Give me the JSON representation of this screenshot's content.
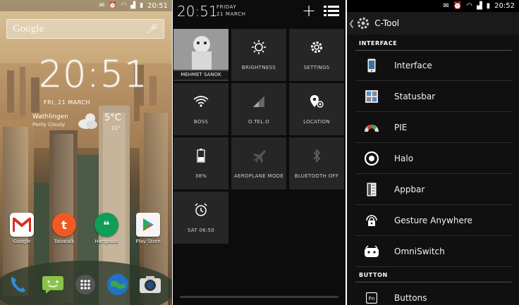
{
  "home": {
    "status_time": "20:51",
    "search_logo": "Google",
    "clock": "20:51",
    "date": "FRI, 21 MARCH",
    "weather_location": "Wathlingen",
    "weather_condition": "Partly Cloudy",
    "weather_temp": "5°C",
    "weather_hilo": "11°",
    "apps": [
      {
        "label": "Google"
      },
      {
        "label": "Tabatalk"
      },
      {
        "label": "Hangouts"
      },
      {
        "label": "Play Store"
      }
    ],
    "dock": [
      "phone-icon",
      "messaging-icon",
      "app-drawer-icon",
      "browser-globe-icon",
      "camera-icon"
    ]
  },
  "quick_settings": {
    "time": "20:51",
    "day": "FRIDAY",
    "date": "21 MARCH",
    "user_name": "MEHMET SANOK",
    "tiles": [
      {
        "label": "BRIGHTNESS",
        "icon": "brightness-icon"
      },
      {
        "label": "SETTINGS",
        "icon": "settings-gear-icon"
      },
      {
        "label": "BOSS",
        "icon": "wifi-icon"
      },
      {
        "label": "O.TEL.O",
        "icon": "signal-icon"
      },
      {
        "label": "LOCATION",
        "icon": "location-icon"
      },
      {
        "label": "38%",
        "icon": "battery-icon"
      },
      {
        "label": "AEROPLANE MODE",
        "icon": "airplane-icon"
      },
      {
        "label": "BLUETOOTH OFF",
        "icon": "bluetooth-icon"
      },
      {
        "label": "SAT 06:50",
        "icon": "alarm-icon"
      }
    ]
  },
  "ctool": {
    "status_time": "20:52",
    "title": "C-Tool",
    "section_interface": "INTERFACE",
    "section_button": "BUTTON",
    "items": [
      {
        "label": "Interface",
        "icon": "phone-interface-icon"
      },
      {
        "label": "Statusbar",
        "icon": "statusbar-icon"
      },
      {
        "label": "PIE",
        "icon": "pie-icon"
      },
      {
        "label": "Halo",
        "icon": "halo-icon"
      },
      {
        "label": "Appbar",
        "icon": "appbar-icon"
      },
      {
        "label": "Gesture Anywhere",
        "icon": "gesture-lock-icon"
      },
      {
        "label": "OmniSwitch",
        "icon": "omniswitch-icon"
      },
      {
        "label": "Buttons",
        "icon": "fn-key-icon"
      }
    ],
    "colors": {
      "background": "#101010",
      "divider": "#505050"
    }
  }
}
